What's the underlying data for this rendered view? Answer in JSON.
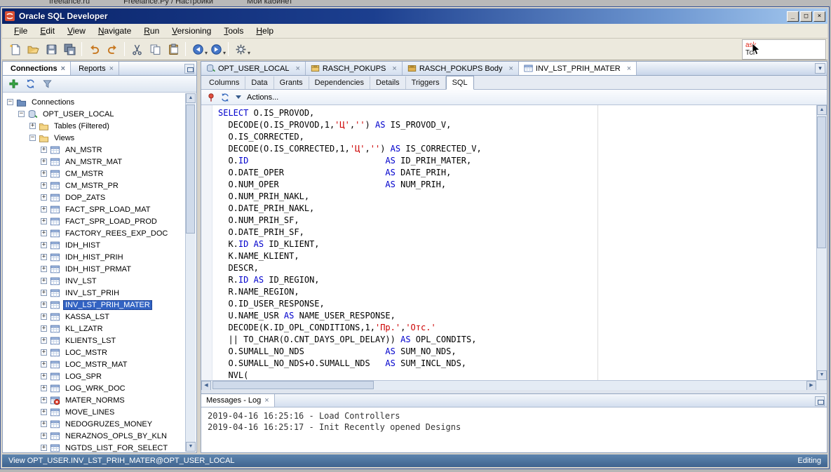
{
  "top_strip": {
    "items": [
      "freelance.ru",
      "Freelance.Ру / Настройки",
      "Мой кабинет"
    ]
  },
  "window": {
    "title": "Oracle SQL Developer",
    "controls": {
      "minimize": "_",
      "restore": "□",
      "close": "×"
    }
  },
  "menubar": {
    "items": [
      "File",
      "Edit",
      "View",
      "Navigate",
      "Run",
      "Versioning",
      "Tools",
      "Help"
    ]
  },
  "toolbar": {
    "buttons": [
      {
        "name": "new-file-button",
        "icon": "new-file"
      },
      {
        "name": "open-file-button",
        "icon": "open-folder"
      },
      {
        "name": "save-button",
        "icon": "save"
      },
      {
        "name": "save-all-button",
        "icon": "save-all"
      },
      {
        "sep": true
      },
      {
        "name": "undo-button",
        "icon": "undo"
      },
      {
        "name": "redo-button",
        "icon": "redo"
      },
      {
        "sep": true
      },
      {
        "name": "cut-button",
        "icon": "cut"
      },
      {
        "name": "copy-button",
        "icon": "copy"
      },
      {
        "name": "paste-button",
        "icon": "paste"
      },
      {
        "sep": true
      },
      {
        "name": "back-button",
        "icon": "back",
        "dropdown": true
      },
      {
        "name": "forward-button",
        "icon": "forward",
        "dropdown": true
      },
      {
        "sep": true
      },
      {
        "name": "sql-worksheet-button",
        "icon": "db-tool",
        "dropdown": true
      }
    ]
  },
  "note": {
    "line1": "ask",
    "line2": "Топ"
  },
  "left_panel": {
    "tabs": [
      {
        "label": "Connections",
        "icon": "database",
        "active": true
      },
      {
        "label": "Reports",
        "icon": "reports",
        "active": false
      }
    ],
    "toolbar": [
      {
        "name": "add-connection-button",
        "icon": "plus"
      },
      {
        "name": "refresh-button",
        "icon": "refresh"
      },
      {
        "name": "filter-button",
        "icon": "filter"
      }
    ],
    "tree": [
      {
        "label": "Connections",
        "level": 0,
        "icon": "connections",
        "exp": "minus"
      },
      {
        "label": "OPT_USER_LOCAL",
        "level": 1,
        "icon": "database",
        "exp": "minus"
      },
      {
        "label": "Tables (Filtered)",
        "level": 2,
        "icon": "folder",
        "exp": "plus"
      },
      {
        "label": "Views",
        "level": 2,
        "icon": "folder",
        "exp": "minus"
      },
      {
        "label": "AN_MSTR",
        "level": 3,
        "icon": "view",
        "exp": "plus"
      },
      {
        "label": "AN_MSTR_MAT",
        "level": 3,
        "icon": "view",
        "exp": "plus"
      },
      {
        "label": "CM_MSTR",
        "level": 3,
        "icon": "view",
        "exp": "plus"
      },
      {
        "label": "CM_MSTR_PR",
        "level": 3,
        "icon": "view",
        "exp": "plus"
      },
      {
        "label": "DOP_ZATS",
        "level": 3,
        "icon": "view",
        "exp": "plus"
      },
      {
        "label": "FACT_SPR_LOAD_MAT",
        "level": 3,
        "icon": "view",
        "exp": "plus"
      },
      {
        "label": "FACT_SPR_LOAD_PROD",
        "level": 3,
        "icon": "view",
        "exp": "plus"
      },
      {
        "label": "FACTORY_REES_EXP_DOC",
        "level": 3,
        "icon": "view",
        "exp": "plus"
      },
      {
        "label": "IDH_HIST",
        "level": 3,
        "icon": "view",
        "exp": "plus"
      },
      {
        "label": "IDH_HIST_PRIH",
        "level": 3,
        "icon": "view",
        "exp": "plus"
      },
      {
        "label": "IDH_HIST_PRMAT",
        "level": 3,
        "icon": "view",
        "exp": "plus"
      },
      {
        "label": "INV_LST",
        "level": 3,
        "icon": "view",
        "exp": "plus"
      },
      {
        "label": "INV_LST_PRIH",
        "level": 3,
        "icon": "view",
        "exp": "plus"
      },
      {
        "label": "INV_LST_PRIH_MATER",
        "level": 3,
        "icon": "view",
        "exp": "plus",
        "selected": true
      },
      {
        "label": "KASSA_LST",
        "level": 3,
        "icon": "view",
        "exp": "plus"
      },
      {
        "label": "KL_LZATR",
        "level": 3,
        "icon": "view",
        "exp": "plus"
      },
      {
        "label": "KLIENTS_LST",
        "level": 3,
        "icon": "view",
        "exp": "plus"
      },
      {
        "label": "LOC_MSTR",
        "level": 3,
        "icon": "view",
        "exp": "plus"
      },
      {
        "label": "LOC_MSTR_MAT",
        "level": 3,
        "icon": "view",
        "exp": "plus"
      },
      {
        "label": "LOG_SPR",
        "level": 3,
        "icon": "view",
        "exp": "plus"
      },
      {
        "label": "LOG_WRK_DOC",
        "level": 3,
        "icon": "view",
        "exp": "plus"
      },
      {
        "label": "MATER_NORMS",
        "level": 3,
        "icon": "view-error",
        "exp": "plus"
      },
      {
        "label": "MOVE_LINES",
        "level": 3,
        "icon": "view",
        "exp": "plus"
      },
      {
        "label": "NEDOGRUZES_MONEY",
        "level": 3,
        "icon": "view",
        "exp": "plus"
      },
      {
        "label": "NERAZNOS_OPLS_BY_KLN",
        "level": 3,
        "icon": "view",
        "exp": "plus"
      },
      {
        "label": "NGTDS_LIST_FOR_SELECT",
        "level": 3,
        "icon": "view",
        "exp": "plus"
      }
    ]
  },
  "editor": {
    "tabs": [
      {
        "label": "OPT_USER_LOCAL",
        "icon": "database"
      },
      {
        "label": "RASCH_POKUPS",
        "icon": "package"
      },
      {
        "label": "RASCH_POKUPS Body",
        "icon": "package-body"
      },
      {
        "label": "INV_LST_PRIH_MATER",
        "icon": "view",
        "active": true
      }
    ],
    "subtabs": [
      {
        "label": "Columns"
      },
      {
        "label": "Data"
      },
      {
        "label": "Grants"
      },
      {
        "label": "Dependencies"
      },
      {
        "label": "Details"
      },
      {
        "label": "Triggers"
      },
      {
        "label": "SQL",
        "active": true
      }
    ],
    "toolbar": {
      "actions_label": "Actions..."
    },
    "code_lines": [
      "SELECT O.IS_PROVOD,",
      "  DECODE(O.IS_PROVOD,1,'Ц','') AS IS_PROVOD_V,",
      "  O.IS_CORRECTED,",
      "  DECODE(O.IS_CORRECTED,1,'Ц','') AS IS_CORRECTED_V,",
      "  O.ID                           AS ID_PRIH_MATER,",
      "  O.DATE_OPER                    AS DATE_PRIH,",
      "  O.NUM_OPER                     AS NUM_PRIH,",
      "  O.NUM_PRIH_NAKL,",
      "  O.DATE_PRIH_NAKL,",
      "  O.NUM_PRIH_SF,",
      "  O.DATE_PRIH_SF,",
      "  K.ID AS ID_KLIENT,",
      "  K.NAME_KLIENT,",
      "  DESCR,",
      "  R.ID AS ID_REGION,",
      "  R.NAME_REGION,",
      "  O.ID_USER_RESPONSE,",
      "  U.NAME_USR AS NAME_USER_RESPONSE,",
      "  DECODE(K.ID_OPL_CONDITIONS,1,'Пр.','Отс.'",
      "  || TO_CHAR(O.CNT_DAYS_OPL_DELAY)) AS OPL_CONDITS,",
      "  O.SUMALL_NO_NDS                AS SUM_NO_NDS,",
      "  O.SUMALL_NO_NDS+O.SUMALL_NDS   AS SUM_INCL_NDS,",
      "  NVL("
    ]
  },
  "log_panel": {
    "tab": "Messages - Log",
    "lines": [
      "2019-04-16 16:25:16 - Load Controllers",
      "2019-04-16 16:25:17 - Init Recently opened Designs"
    ]
  },
  "statusbar": {
    "left": "View OPT_USER.INV_LST_PRIH_MATER@OPT_USER_LOCAL",
    "right": "Editing"
  },
  "colors": {
    "keyword": "#0000cc",
    "string": "#cc0000",
    "selection": "#3263c3",
    "titlebar_start": "#0a246a",
    "titlebar_end": "#a6caf0",
    "status_bg": "#4a72a2"
  }
}
